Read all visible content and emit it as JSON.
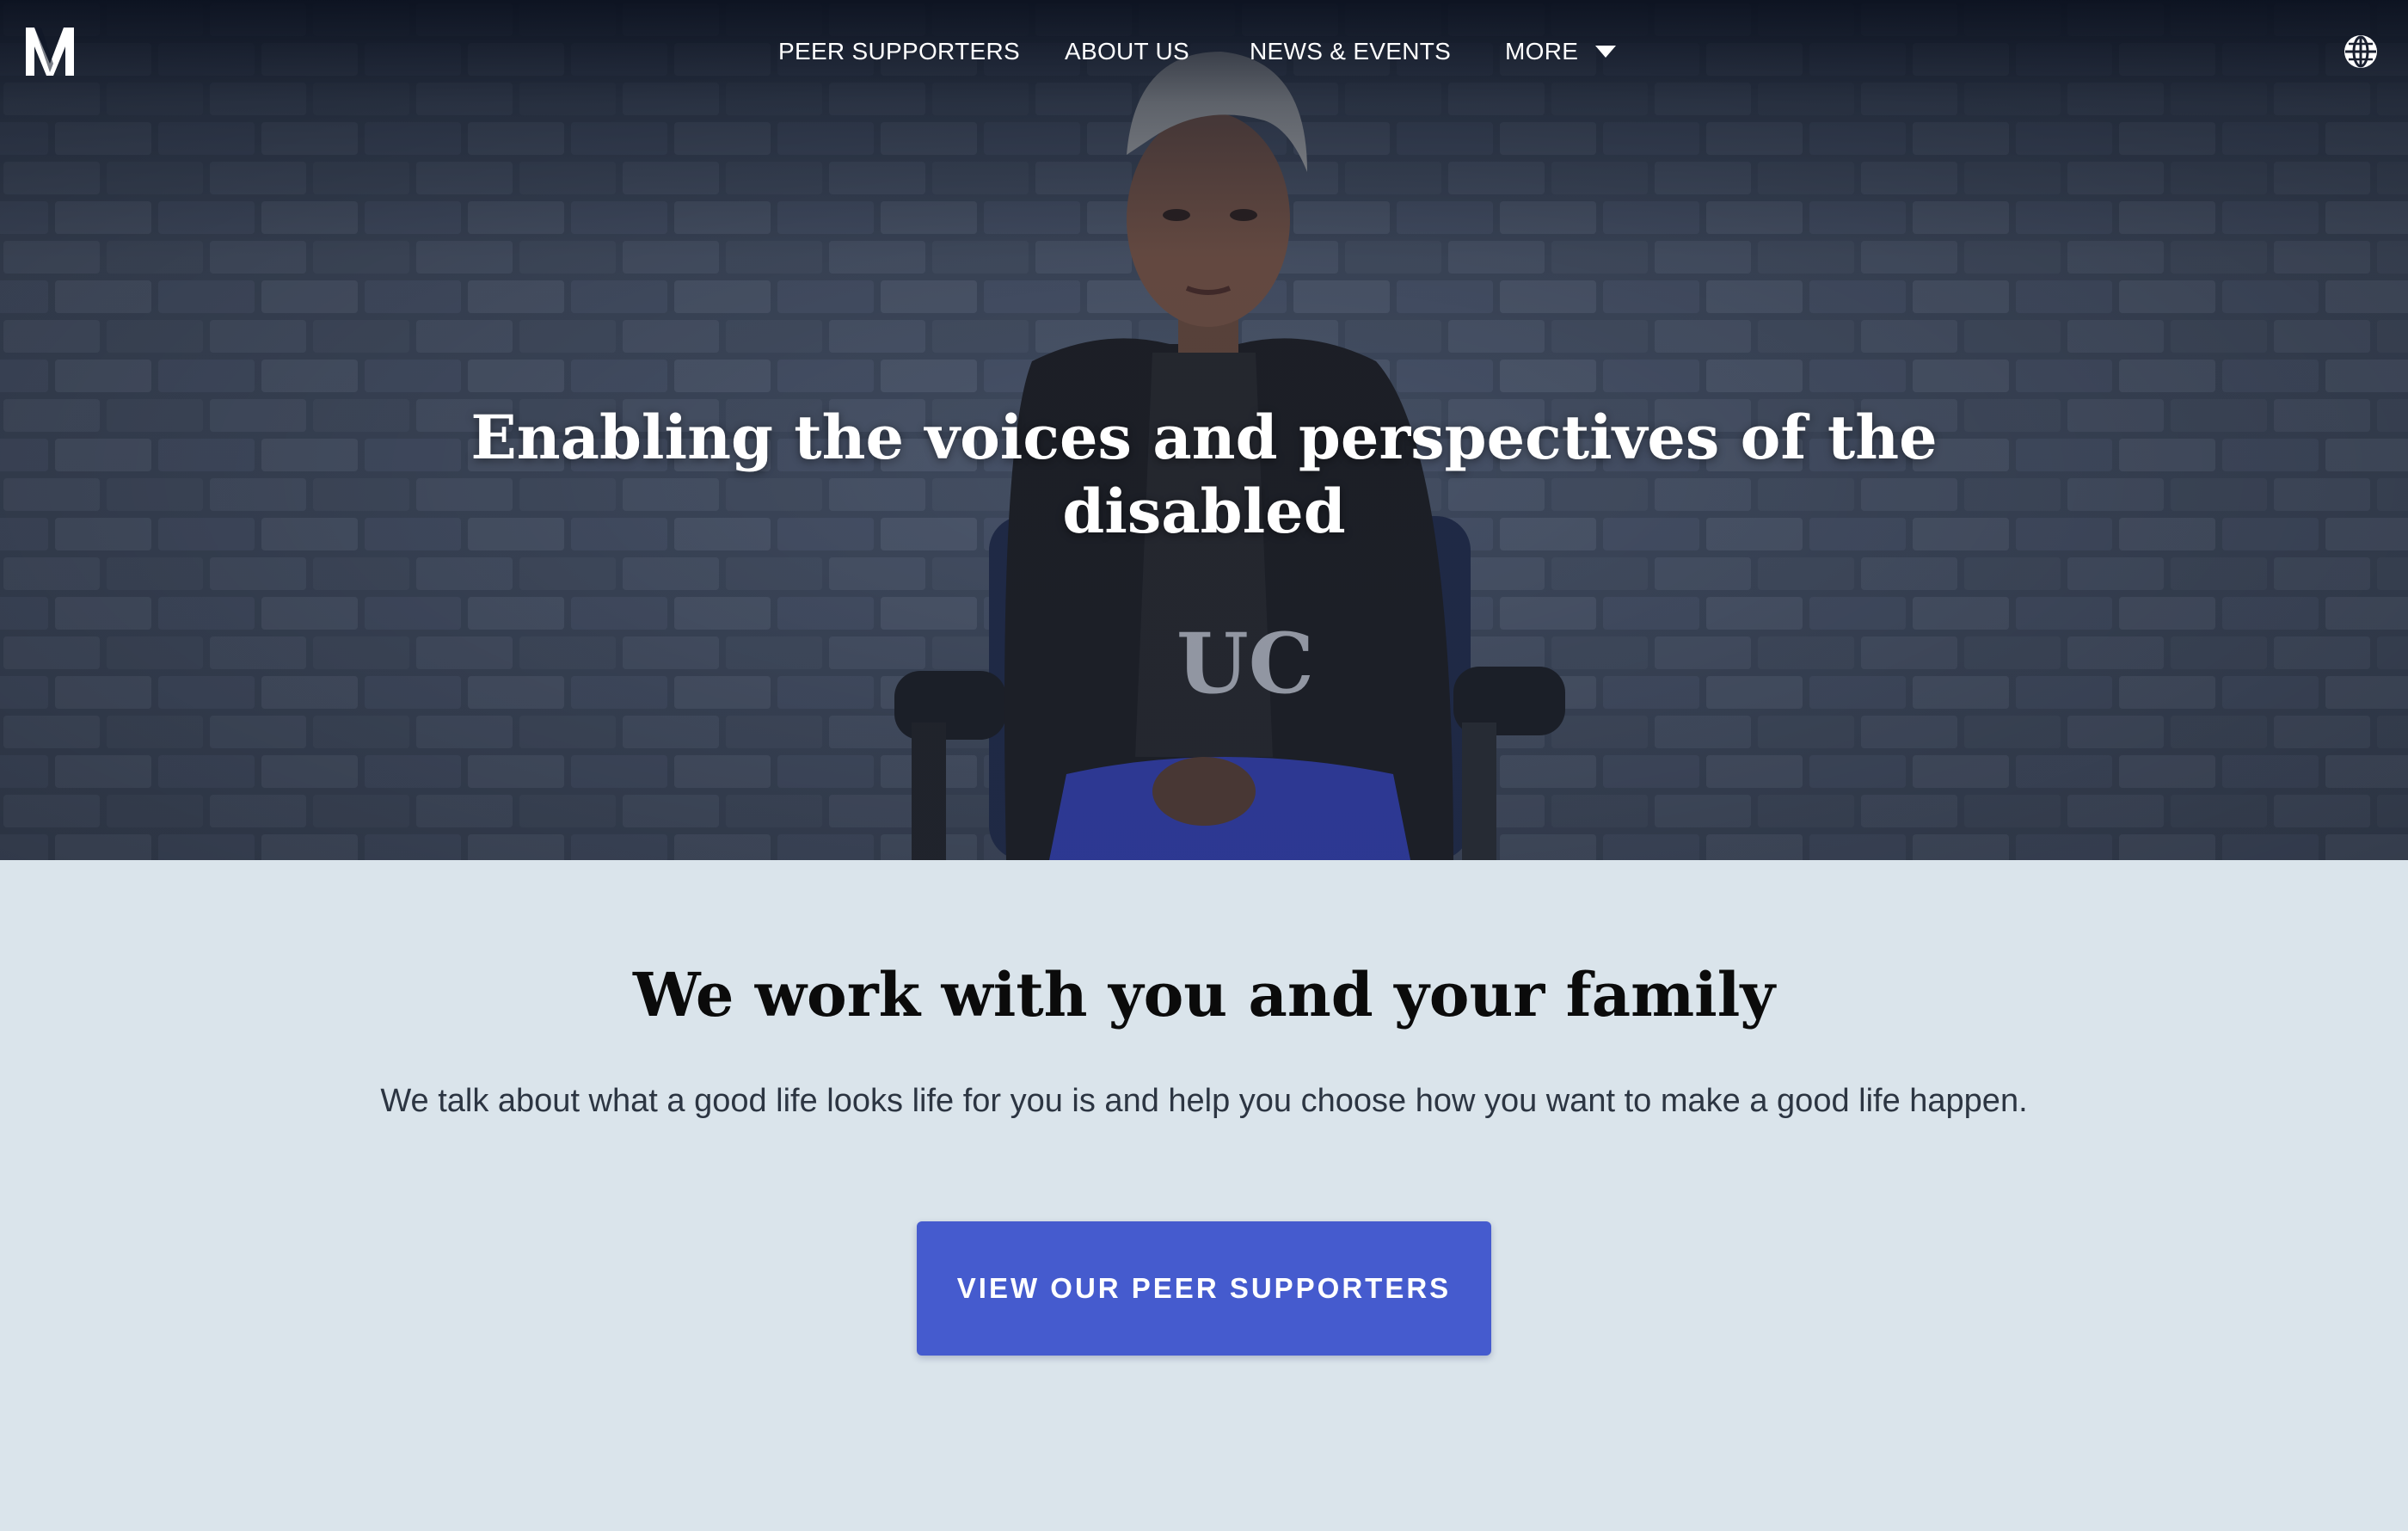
{
  "nav": {
    "logo_label": "M",
    "items": [
      {
        "label": "PEER SUPPORTERS"
      },
      {
        "label": "ABOUT US"
      },
      {
        "label": "NEWS & EVENTS"
      },
      {
        "label": "MORE"
      }
    ],
    "more_icon": "chevron-down-icon",
    "language_icon": "globe-icon"
  },
  "hero": {
    "title": "Enabling the voices and perspectives of the disabled",
    "shirt_text": "UC"
  },
  "section": {
    "title": "We work with you and your family",
    "text": "We talk about what a good life looks life for you is and help you choose how you want to make a good life happen.",
    "cta_label": "VIEW OUR PEER SUPPORTERS"
  },
  "colors": {
    "nav_background": "#0f1626",
    "hero_overlay": "#2a3346",
    "section_background": "#dae4eb",
    "cta_background": "#455bce",
    "heading_text": "#0b0b0b",
    "body_text": "#2c3542"
  }
}
